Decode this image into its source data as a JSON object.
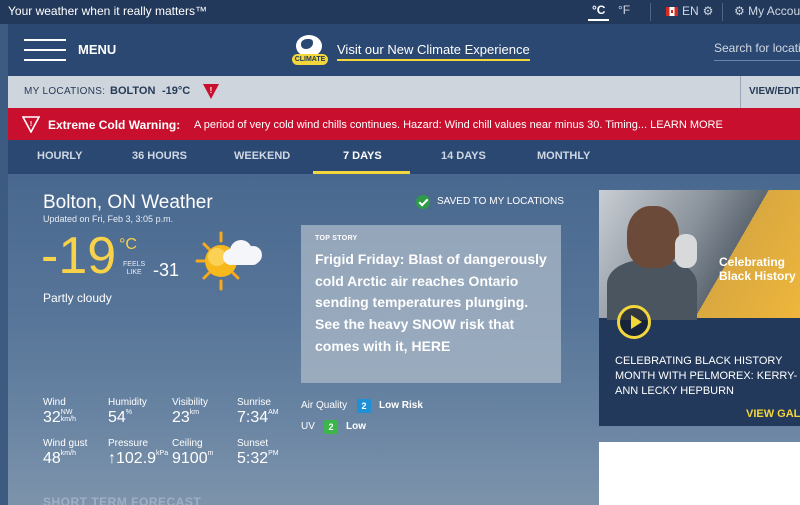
{
  "topbar": {
    "tagline": "Your weather when it really matters™",
    "unit_c": "°C",
    "unit_f": "°F",
    "lang": "EN",
    "account": "My Account"
  },
  "header": {
    "menu_label": "MENU",
    "climate_badge": "CLIMATE",
    "climate_link": "Visit our New Climate Experience",
    "search_placeholder": "Search for location"
  },
  "locations": {
    "label": "MY LOCATIONS:",
    "city": "BOLTON",
    "temp": "-19°C",
    "view_edit": "VIEW/EDIT"
  },
  "warning": {
    "title": "Extreme Cold Warning:",
    "text": "A period of very cold wind chills continues. Hazard: Wind chill values near minus 30. Timing... LEARN MORE"
  },
  "tabs": [
    "HOURLY",
    "36 HOURS",
    "WEEKEND",
    "7 DAYS",
    "14 DAYS",
    "MONTHLY"
  ],
  "current": {
    "city": "Bolton, ON Weather",
    "updated": "Updated on Fri, Feb 3, 3:05 p.m.",
    "temp": "-19",
    "temp_unit": "°C",
    "feels_label_1": "FEELS",
    "feels_label_2": "LIKE",
    "feels_like": "-31",
    "condition": "Partly cloudy",
    "icon": "partly-cloudy-sun-icon",
    "saved": "SAVED TO MY LOCATIONS"
  },
  "story": {
    "tag": "TOP STORY",
    "title": "Frigid Friday: Blast of dangerously cold Arctic air reaches Ontario sending temperatures plunging. See the heavy SNOW risk that comes with it, HERE"
  },
  "stats": {
    "wind": {
      "label": "Wind",
      "value": "32",
      "dir": "NW",
      "unit": "km/h"
    },
    "humidity": {
      "label": "Humidity",
      "value": "54",
      "unit": "%"
    },
    "visibility": {
      "label": "Visibility",
      "value": "23",
      "unit": "km"
    },
    "sunrise": {
      "label": "Sunrise",
      "value": "7:34",
      "unit": "AM"
    },
    "wind_gust": {
      "label": "Wind gust",
      "value": "48",
      "unit": "km/h"
    },
    "pressure": {
      "label": "Pressure",
      "value": "↑102.9",
      "unit": "kPa"
    },
    "ceiling": {
      "label": "Ceiling",
      "value": "9100",
      "unit": "m"
    },
    "sunset": {
      "label": "Sunset",
      "value": "5:32",
      "unit": "PM"
    }
  },
  "air_quality": {
    "label": "Air Quality",
    "value": "2",
    "level": "Low Risk",
    "color": "#1e90d6"
  },
  "uv": {
    "label": "UV",
    "value": "2",
    "level": "Low",
    "color": "#3cb54a"
  },
  "short_term": "SHORT TERM FORECAST",
  "gallery": {
    "image_text_1": "Celebrating",
    "image_text_2": "Black History",
    "caption": "CELEBRATING BLACK HISTORY MONTH WITH PELMOREX: KERRY-ANN LECKY HEPBURN",
    "link": "VIEW GALLERY"
  },
  "colors": {
    "accent_yellow": "#f2d63b",
    "warning_red": "#c8102e",
    "nav_blue": "#2b4872"
  }
}
